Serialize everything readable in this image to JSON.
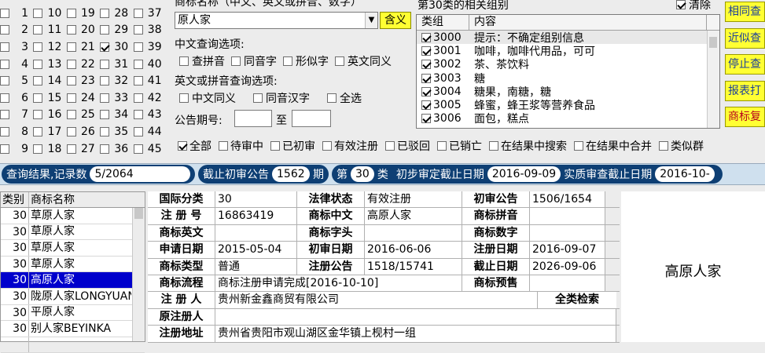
{
  "classes": {
    "rows": [
      [
        {
          "n": "1",
          "on": false
        },
        {
          "n": "10",
          "on": false
        },
        {
          "n": "19",
          "on": false
        },
        {
          "n": "28",
          "on": false
        },
        {
          "n": "37",
          "on": false
        }
      ],
      [
        {
          "n": "2",
          "on": false
        },
        {
          "n": "11",
          "on": false
        },
        {
          "n": "20",
          "on": false
        },
        {
          "n": "29",
          "on": false
        },
        {
          "n": "38",
          "on": false
        }
      ],
      [
        {
          "n": "3",
          "on": false
        },
        {
          "n": "12",
          "on": false
        },
        {
          "n": "21",
          "on": false
        },
        {
          "n": "30",
          "on": true
        },
        {
          "n": "39",
          "on": false
        }
      ],
      [
        {
          "n": "4",
          "on": false
        },
        {
          "n": "13",
          "on": false
        },
        {
          "n": "22",
          "on": false
        },
        {
          "n": "31",
          "on": false
        },
        {
          "n": "40",
          "on": false
        }
      ],
      [
        {
          "n": "5",
          "on": false
        },
        {
          "n": "14",
          "on": false
        },
        {
          "n": "23",
          "on": false
        },
        {
          "n": "32",
          "on": false
        },
        {
          "n": "41",
          "on": false
        }
      ],
      [
        {
          "n": "6",
          "on": false
        },
        {
          "n": "15",
          "on": false
        },
        {
          "n": "24",
          "on": false
        },
        {
          "n": "33",
          "on": false
        },
        {
          "n": "42",
          "on": false
        }
      ],
      [
        {
          "n": "7",
          "on": false
        },
        {
          "n": "16",
          "on": false
        },
        {
          "n": "25",
          "on": false
        },
        {
          "n": "34",
          "on": false
        },
        {
          "n": "43",
          "on": false
        }
      ],
      [
        {
          "n": "8",
          "on": false
        },
        {
          "n": "17",
          "on": false
        },
        {
          "n": "26",
          "on": false
        },
        {
          "n": "35",
          "on": false
        },
        {
          "n": "44",
          "on": false
        }
      ],
      [
        {
          "n": "9",
          "on": false
        },
        {
          "n": "18",
          "on": false
        },
        {
          "n": "27",
          "on": false
        },
        {
          "n": "36",
          "on": false
        },
        {
          "n": "45",
          "on": false
        }
      ]
    ]
  },
  "query": {
    "name_label": "商标名称（中文、英文或拼音、数字）",
    "name_value": "原人家",
    "hanyi_button": "含义",
    "cn_options_label": "中文查询选项:",
    "cn_options": [
      {
        "label": "查拼音",
        "on": false
      },
      {
        "label": "同音字",
        "on": false
      },
      {
        "label": "形似字",
        "on": false
      },
      {
        "label": "英文同义",
        "on": false
      }
    ],
    "en_options_label": "英文或拼音查询选项:",
    "en_options": [
      {
        "label": "中文同义",
        "on": false
      },
      {
        "label": "同音汉字",
        "on": false
      },
      {
        "label": "全选",
        "on": false
      }
    ],
    "gazette_label": "公告期号:",
    "gazette_to": "至",
    "gazette_from_value": "",
    "gazette_to_value": ""
  },
  "groups": {
    "title": "第30类的相关组别",
    "clear_label": "清除",
    "clear_on": true,
    "col_group": "类组",
    "col_content": "内容",
    "rows": [
      {
        "code": "3000",
        "desc": "提示：不确定组别信息",
        "on": true
      },
      {
        "code": "3001",
        "desc": "咖啡，咖啡代用品，可可",
        "on": true
      },
      {
        "code": "3002",
        "desc": "茶、茶饮料",
        "on": true
      },
      {
        "code": "3003",
        "desc": "糖",
        "on": true
      },
      {
        "code": "3004",
        "desc": "糖果，南糖，糖",
        "on": true
      },
      {
        "code": "3005",
        "desc": "蜂蜜，蜂王浆等营养食品",
        "on": true
      },
      {
        "code": "3006",
        "desc": "面包，糕点",
        "on": true
      }
    ]
  },
  "side_buttons": [
    "相同查",
    "近似查",
    "停止查",
    "报表打",
    "商标复"
  ],
  "filters": [
    {
      "label": "全部",
      "on": true
    },
    {
      "label": "待审中",
      "on": false
    },
    {
      "label": "已初审",
      "on": false
    },
    {
      "label": "有效注册",
      "on": false
    },
    {
      "label": "已驳回",
      "on": false
    },
    {
      "label": "已销亡",
      "on": false
    },
    {
      "label": "在结果中搜索",
      "on": false
    },
    {
      "label": "在结果中合并",
      "on": false
    },
    {
      "label": "类似群",
      "on": false
    }
  ],
  "status": {
    "result_label": "查询结果,记录数",
    "result_value": "5/2064",
    "cutoff_label": "截止初审公告",
    "cutoff_value": "1562",
    "cutoff_unit": "期",
    "class_prefix": "第",
    "class_value": "30",
    "class_suffix": "类",
    "prelim_label": "初步审定截止日期",
    "prelim_value": "2016-09-09",
    "actual_label": "实质审查截止日期",
    "actual_value": "2016-10-"
  },
  "results": {
    "col_class": "类别",
    "col_name": "商标名称",
    "rows": [
      {
        "cls": "30",
        "name": "草原人家",
        "sel": false
      },
      {
        "cls": "30",
        "name": "草原人家",
        "sel": false
      },
      {
        "cls": "30",
        "name": "草原人家",
        "sel": false
      },
      {
        "cls": "30",
        "name": "草原人家",
        "sel": false
      },
      {
        "cls": "30",
        "name": "高原人家",
        "sel": true
      },
      {
        "cls": "30",
        "name": "陇原人家LONGYUAN",
        "sel": false
      },
      {
        "cls": "30",
        "name": "平原人家",
        "sel": false
      },
      {
        "cls": "30",
        "name": "别人家BEYINKA",
        "sel": false
      },
      {
        "cls": "",
        "name": "",
        "sel": false
      }
    ]
  },
  "detail": {
    "intl_class_label": "国际分类",
    "intl_class": "30",
    "legal_status_label": "法律状态",
    "legal_status": "有效注册",
    "prelim_pub_label": "初审公告",
    "prelim_pub": "1506/1654",
    "reg_no_label": "注 册 号",
    "reg_no": "16863419",
    "tm_cn_label": "商标中文",
    "tm_cn": "高原人家",
    "tm_pinyin_label": "商标拼音",
    "tm_pinyin": "",
    "tm_en_label": "商标英文",
    "tm_en": "",
    "tm_initial_label": "商标字头",
    "tm_initial": "",
    "tm_digit_label": "商标数字",
    "tm_digit": "",
    "apply_date_label": "申请日期",
    "apply_date": "2015-05-04",
    "prelim_date_label": "初审日期",
    "prelim_date": "2016-06-06",
    "reg_date_label": "注册日期",
    "reg_date": "2016-09-07",
    "tm_type_label": "商标类型",
    "tm_type": "普通",
    "reg_pub_label": "注册公告",
    "reg_pub": "1518/15741",
    "expire_label": "截止日期",
    "expire": "2026-09-06",
    "flow_label": "商标流程",
    "flow": "商标注册申请完成[2016-10-10]",
    "notice_label": "商标预售",
    "notice": "",
    "registrant_label": "注 册 人",
    "registrant": "贵州新金鑫商贸有限公司",
    "full_search": "全类检索",
    "orig_registrant_label": "原注册人",
    "orig_registrant": "",
    "address_label": "注册地址",
    "address": "贵州省贵阳市观山湖区金华镇上枧村一组"
  },
  "preview": {
    "text": "高原人家"
  }
}
